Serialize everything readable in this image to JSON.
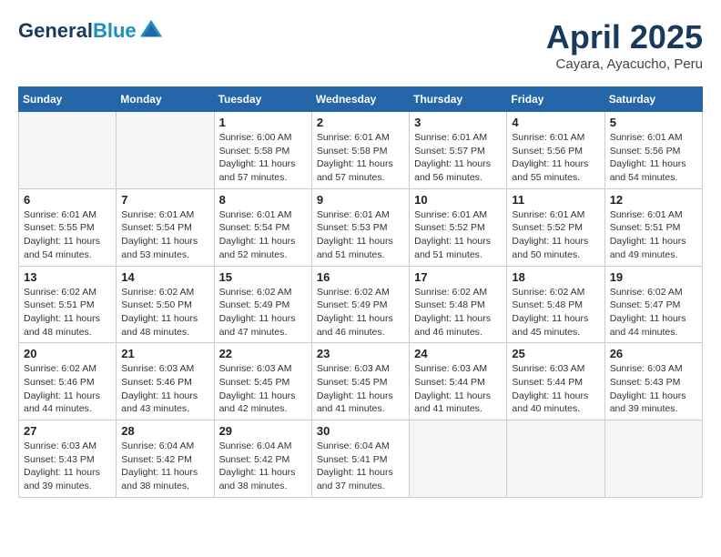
{
  "header": {
    "logo_line1": "General",
    "logo_line2": "Blue",
    "month_title": "April 2025",
    "location": "Cayara, Ayacucho, Peru"
  },
  "weekdays": [
    "Sunday",
    "Monday",
    "Tuesday",
    "Wednesday",
    "Thursday",
    "Friday",
    "Saturday"
  ],
  "weeks": [
    [
      {
        "day": "",
        "sunrise": "",
        "sunset": "",
        "daylight": ""
      },
      {
        "day": "",
        "sunrise": "",
        "sunset": "",
        "daylight": ""
      },
      {
        "day": "1",
        "sunrise": "Sunrise: 6:00 AM",
        "sunset": "Sunset: 5:58 PM",
        "daylight": "Daylight: 11 hours and 57 minutes."
      },
      {
        "day": "2",
        "sunrise": "Sunrise: 6:01 AM",
        "sunset": "Sunset: 5:58 PM",
        "daylight": "Daylight: 11 hours and 57 minutes."
      },
      {
        "day": "3",
        "sunrise": "Sunrise: 6:01 AM",
        "sunset": "Sunset: 5:57 PM",
        "daylight": "Daylight: 11 hours and 56 minutes."
      },
      {
        "day": "4",
        "sunrise": "Sunrise: 6:01 AM",
        "sunset": "Sunset: 5:56 PM",
        "daylight": "Daylight: 11 hours and 55 minutes."
      },
      {
        "day": "5",
        "sunrise": "Sunrise: 6:01 AM",
        "sunset": "Sunset: 5:56 PM",
        "daylight": "Daylight: 11 hours and 54 minutes."
      }
    ],
    [
      {
        "day": "6",
        "sunrise": "Sunrise: 6:01 AM",
        "sunset": "Sunset: 5:55 PM",
        "daylight": "Daylight: 11 hours and 54 minutes."
      },
      {
        "day": "7",
        "sunrise": "Sunrise: 6:01 AM",
        "sunset": "Sunset: 5:54 PM",
        "daylight": "Daylight: 11 hours and 53 minutes."
      },
      {
        "day": "8",
        "sunrise": "Sunrise: 6:01 AM",
        "sunset": "Sunset: 5:54 PM",
        "daylight": "Daylight: 11 hours and 52 minutes."
      },
      {
        "day": "9",
        "sunrise": "Sunrise: 6:01 AM",
        "sunset": "Sunset: 5:53 PM",
        "daylight": "Daylight: 11 hours and 51 minutes."
      },
      {
        "day": "10",
        "sunrise": "Sunrise: 6:01 AM",
        "sunset": "Sunset: 5:52 PM",
        "daylight": "Daylight: 11 hours and 51 minutes."
      },
      {
        "day": "11",
        "sunrise": "Sunrise: 6:01 AM",
        "sunset": "Sunset: 5:52 PM",
        "daylight": "Daylight: 11 hours and 50 minutes."
      },
      {
        "day": "12",
        "sunrise": "Sunrise: 6:01 AM",
        "sunset": "Sunset: 5:51 PM",
        "daylight": "Daylight: 11 hours and 49 minutes."
      }
    ],
    [
      {
        "day": "13",
        "sunrise": "Sunrise: 6:02 AM",
        "sunset": "Sunset: 5:51 PM",
        "daylight": "Daylight: 11 hours and 48 minutes."
      },
      {
        "day": "14",
        "sunrise": "Sunrise: 6:02 AM",
        "sunset": "Sunset: 5:50 PM",
        "daylight": "Daylight: 11 hours and 48 minutes."
      },
      {
        "day": "15",
        "sunrise": "Sunrise: 6:02 AM",
        "sunset": "Sunset: 5:49 PM",
        "daylight": "Daylight: 11 hours and 47 minutes."
      },
      {
        "day": "16",
        "sunrise": "Sunrise: 6:02 AM",
        "sunset": "Sunset: 5:49 PM",
        "daylight": "Daylight: 11 hours and 46 minutes."
      },
      {
        "day": "17",
        "sunrise": "Sunrise: 6:02 AM",
        "sunset": "Sunset: 5:48 PM",
        "daylight": "Daylight: 11 hours and 46 minutes."
      },
      {
        "day": "18",
        "sunrise": "Sunrise: 6:02 AM",
        "sunset": "Sunset: 5:48 PM",
        "daylight": "Daylight: 11 hours and 45 minutes."
      },
      {
        "day": "19",
        "sunrise": "Sunrise: 6:02 AM",
        "sunset": "Sunset: 5:47 PM",
        "daylight": "Daylight: 11 hours and 44 minutes."
      }
    ],
    [
      {
        "day": "20",
        "sunrise": "Sunrise: 6:02 AM",
        "sunset": "Sunset: 5:46 PM",
        "daylight": "Daylight: 11 hours and 44 minutes."
      },
      {
        "day": "21",
        "sunrise": "Sunrise: 6:03 AM",
        "sunset": "Sunset: 5:46 PM",
        "daylight": "Daylight: 11 hours and 43 minutes."
      },
      {
        "day": "22",
        "sunrise": "Sunrise: 6:03 AM",
        "sunset": "Sunset: 5:45 PM",
        "daylight": "Daylight: 11 hours and 42 minutes."
      },
      {
        "day": "23",
        "sunrise": "Sunrise: 6:03 AM",
        "sunset": "Sunset: 5:45 PM",
        "daylight": "Daylight: 11 hours and 41 minutes."
      },
      {
        "day": "24",
        "sunrise": "Sunrise: 6:03 AM",
        "sunset": "Sunset: 5:44 PM",
        "daylight": "Daylight: 11 hours and 41 minutes."
      },
      {
        "day": "25",
        "sunrise": "Sunrise: 6:03 AM",
        "sunset": "Sunset: 5:44 PM",
        "daylight": "Daylight: 11 hours and 40 minutes."
      },
      {
        "day": "26",
        "sunrise": "Sunrise: 6:03 AM",
        "sunset": "Sunset: 5:43 PM",
        "daylight": "Daylight: 11 hours and 39 minutes."
      }
    ],
    [
      {
        "day": "27",
        "sunrise": "Sunrise: 6:03 AM",
        "sunset": "Sunset: 5:43 PM",
        "daylight": "Daylight: 11 hours and 39 minutes."
      },
      {
        "day": "28",
        "sunrise": "Sunrise: 6:04 AM",
        "sunset": "Sunset: 5:42 PM",
        "daylight": "Daylight: 11 hours and 38 minutes."
      },
      {
        "day": "29",
        "sunrise": "Sunrise: 6:04 AM",
        "sunset": "Sunset: 5:42 PM",
        "daylight": "Daylight: 11 hours and 38 minutes."
      },
      {
        "day": "30",
        "sunrise": "Sunrise: 6:04 AM",
        "sunset": "Sunset: 5:41 PM",
        "daylight": "Daylight: 11 hours and 37 minutes."
      },
      {
        "day": "",
        "sunrise": "",
        "sunset": "",
        "daylight": ""
      },
      {
        "day": "",
        "sunrise": "",
        "sunset": "",
        "daylight": ""
      },
      {
        "day": "",
        "sunrise": "",
        "sunset": "",
        "daylight": ""
      }
    ]
  ]
}
